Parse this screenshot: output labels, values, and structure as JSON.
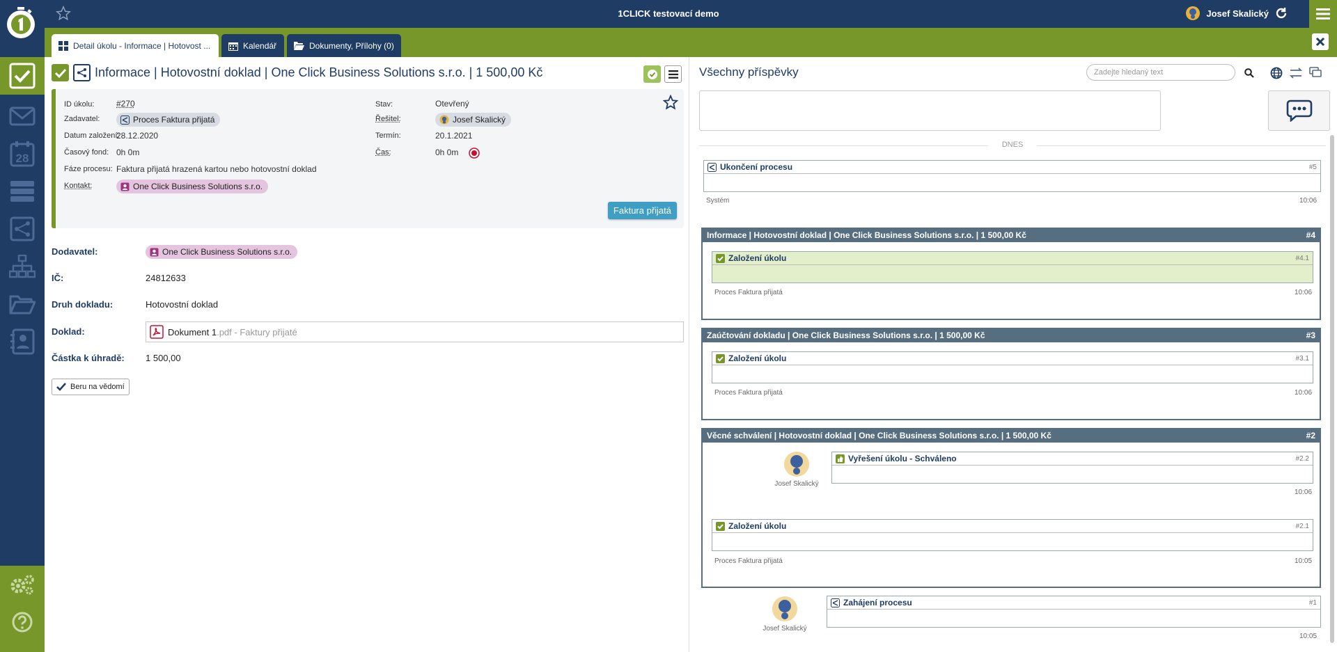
{
  "topbar": {
    "title": "1CLICK testovací demo",
    "user": "Josef Skalický"
  },
  "tabs": [
    {
      "label": "Detail úkolu - Informace | Hotovost ..."
    },
    {
      "label": "Kalendář"
    },
    {
      "label": "Dokumenty, Přílohy (0)"
    }
  ],
  "task": {
    "title": "Informace | Hotovostní doklad | One Click Business Solutions s.r.o. | 1 500,00 Kč",
    "id_label": "ID úkolu:",
    "id": "#270",
    "zadavatel_label": "Zadavatel:",
    "zadavatel": "Proces Faktura přijatá",
    "datum_label": "Datum založení:",
    "datum": "28.12.2020",
    "fond_label": "Časový fond:",
    "fond": "0h 0m",
    "faze_label": "Fáze procesu:",
    "faze": "Faktura přijatá hrazená kartou nebo hotovostní doklad",
    "kontakt_label": "Kontakt:",
    "kontakt": "One Click Business Solutions s.r.o.",
    "stav_label": "Stav:",
    "stav": "Otevřený",
    "resitel_label": "Řešitel:",
    "resitel": "Josef Skalický",
    "termin_label": "Termín:",
    "termin": "20.1.2021",
    "cas_label": "Čas:",
    "cas": "0h 0m",
    "badge": "Faktura přijatá"
  },
  "fields": {
    "dodavatel_label": "Dodavatel:",
    "dodavatel": "One Click Business Solutions s.r.o.",
    "ic_label": "IČ:",
    "ic": "24812633",
    "druh_label": "Druh dokladu:",
    "druh": "Hotovostní doklad",
    "doklad_label": "Doklad:",
    "doklad_name": "Dokument 1",
    "doklad_ext": ".pdf - Faktury přijaté",
    "castka_label": "Částka k úhradě:",
    "castka": "1 500,00",
    "ack_button": "Beru na vědomí"
  },
  "posts": {
    "title": "Všechny příspěvky",
    "search_placeholder": "Zadejte hledaný text",
    "day_divider": "DNES",
    "p5": {
      "title": "Ukončení procesu",
      "num": "#5",
      "author": "Systém",
      "time": "10:06"
    },
    "g4": {
      "title": "Informace | Hotovostní doklad | One Click Business Solutions s.r.o. | 1 500,00 Kč",
      "num": "#4",
      "c1": {
        "title": "Založení úkolu",
        "num": "#4.1",
        "author": "Proces Faktura přijatá",
        "time": "10:06"
      }
    },
    "g3": {
      "title": "Zaúčtování dokladu | One Click Business Solutions s.r.o. | 1 500,00 Kč",
      "num": "#3",
      "c1": {
        "title": "Založení úkolu",
        "num": "#3.1",
        "author": "Proces Faktura přijatá",
        "time": "10:06"
      }
    },
    "g2": {
      "title": "Věcné schválení | Hotovostní doklad | One Click Business Solutions s.r.o. | 1 500,00 Kč",
      "num": "#2",
      "c2": {
        "title": "Vyřešení úkolu - Schváleno",
        "num": "#2.2",
        "author": "Josef Skalický",
        "time": "10:06"
      },
      "c1": {
        "title": "Založení úkolu",
        "num": "#2.1",
        "author": "Proces Faktura přijatá",
        "time": "10:05"
      }
    },
    "p1": {
      "title": "Zahájení procesu",
      "num": "#1",
      "author": "Josef Skalický",
      "time": "10:05"
    }
  },
  "colors": {
    "navy": "#1f3c64",
    "green": "#78972a",
    "teal": "#3e9ec4",
    "slate": "#566e80"
  }
}
